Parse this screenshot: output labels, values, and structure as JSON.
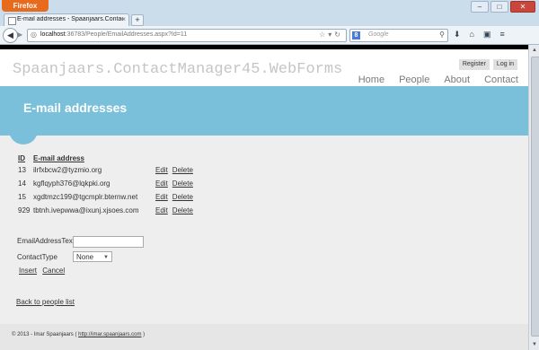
{
  "browser": {
    "app_button": "Firefox",
    "window_controls": [
      "–",
      "□",
      "✕"
    ],
    "tab_title": "E-mail addresses - Spaanjaars.ContactM...",
    "tab_close": "×",
    "new_tab": "+",
    "url_host": "localhost",
    "url_path": ":36783/People/EmailAddresses.aspx?Id=11",
    "search_engine": "8",
    "search_placeholder": "Google",
    "icons": [
      "back-icon",
      "forward-icon",
      "bookmark-star-icon",
      "reload-icon",
      "search-icon",
      "download-icon",
      "home-icon",
      "menu-icon"
    ]
  },
  "site": {
    "title": "Spaanjaars.ContactManager45.WebForms",
    "auth": {
      "register": "Register",
      "login": "Log in"
    },
    "menu": [
      "Home",
      "People",
      "About",
      "Contact"
    ]
  },
  "page": {
    "title": "E-mail addresses",
    "table": {
      "headers": {
        "id": "ID",
        "email": "E-mail address"
      },
      "rows": [
        {
          "id": "13",
          "email": "ilrfxbcw2@tyzmio.org",
          "edit": "Edit",
          "delete": "Delete"
        },
        {
          "id": "14",
          "email": "kgflqyph376@lqkpki.org",
          "edit": "Edit",
          "delete": "Delete"
        },
        {
          "id": "15",
          "email": "xgdtmzc199@tgcmplr.bternw.net",
          "edit": "Edit",
          "delete": "Delete"
        },
        {
          "id": "929",
          "email": "tbtnh.ivepwwa@ixunj.xjsoes.com",
          "edit": "Edit",
          "delete": "Delete"
        }
      ]
    },
    "form": {
      "email_label": "EmailAddressText",
      "email_value": "",
      "contact_type_label": "ContactType",
      "contact_type_value": "None",
      "insert": "Insert",
      "cancel": "Cancel"
    },
    "back_link": "Back to people list"
  },
  "footer": {
    "copyright": "© 2013 - Imar Spaanjaars ( ",
    "link": "http://imar.spaanjaars.com",
    "close": " )"
  },
  "colors": {
    "accent": "#7ac0da",
    "content_bg": "#eeeeee",
    "footer_bg": "#e6e6e6",
    "firefox_button": "#e86a1d"
  }
}
